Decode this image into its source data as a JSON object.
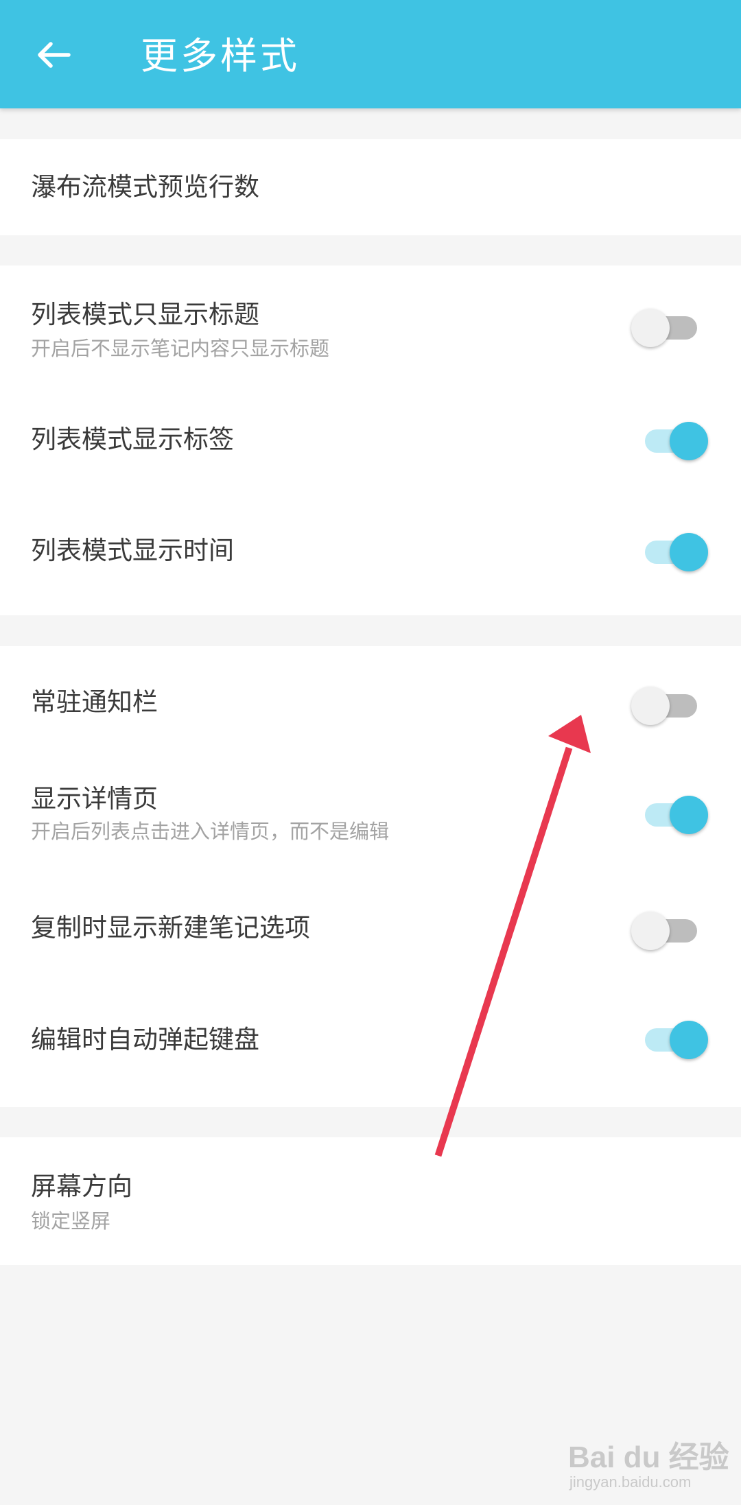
{
  "header": {
    "title": "更多样式",
    "back_icon": "arrow-left-icon",
    "background_color": "#3fc3e3"
  },
  "sections": [
    {
      "rows": [
        {
          "title": "瀑布流模式预览行数"
        }
      ]
    },
    {
      "rows": [
        {
          "title": "列表模式只显示标题",
          "subtitle": "开启后不显示笔记内容只显示标题",
          "toggle": false
        },
        {
          "title": "列表模式显示标签",
          "toggle": true
        },
        {
          "title": "列表模式显示时间",
          "toggle": true
        }
      ]
    },
    {
      "rows": [
        {
          "title": "常驻通知栏",
          "toggle": false
        },
        {
          "title": "显示详情页",
          "subtitle": "开启后列表点击进入详情页，而不是编辑",
          "toggle": true
        },
        {
          "title": "复制时显示新建笔记选项",
          "toggle": false
        },
        {
          "title": "编辑时自动弹起键盘",
          "toggle": true
        }
      ]
    },
    {
      "rows": [
        {
          "title": "屏幕方向",
          "subtitle": "锁定竖屏"
        }
      ]
    }
  ],
  "annotation": {
    "arrow_color": "#e8384f",
    "points_to": "常驻通知栏 toggle"
  },
  "watermark": {
    "main": "Bai du 经验",
    "sub": "jingyan.baidu.com"
  }
}
